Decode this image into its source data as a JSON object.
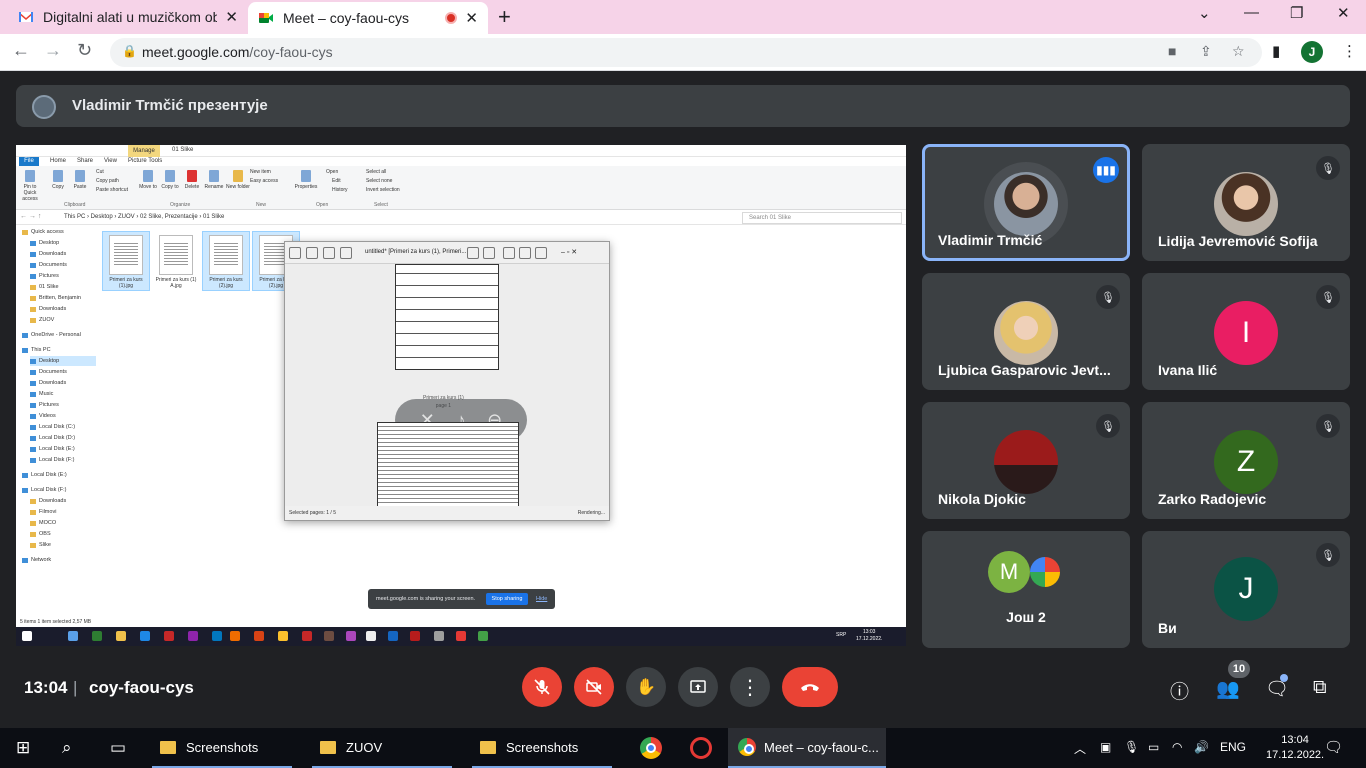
{
  "browser": {
    "tabs": [
      {
        "title": "Digitalni alati u muzičkom obrazovanju",
        "favicon": "gmail-icon"
      },
      {
        "title": "Meet – coy-faou-cys",
        "favicon": "meet-icon",
        "recording": true
      }
    ],
    "url_host": "meet.google.com",
    "url_path": "/coy-faou-cys",
    "profile_initial": "J"
  },
  "presenter_banner": "Vladimir Trmčić презентује",
  "shared_screen": {
    "explorer": {
      "title": "01 Slike",
      "manage_tab": "Manage",
      "ribbon_tabs": [
        "File",
        "Home",
        "Share",
        "View",
        "Picture Tools"
      ],
      "ribbon_buttons": [
        "Pin to Quick access",
        "Copy",
        "Paste",
        "Move to",
        "Copy to",
        "Delete",
        "Rename",
        "New folder",
        "Properties",
        "Open",
        "Select all"
      ],
      "ribbon_small": [
        "Cut",
        "Copy path",
        "Paste shortcut",
        "New item",
        "Easy access",
        "Edit",
        "History",
        "Select none",
        "Invert selection"
      ],
      "ribbon_groups": [
        "Clipboard",
        "Organize",
        "New",
        "Open",
        "Select"
      ],
      "path": "This PC  ›  Desktop  ›  ZUOV  ›  02 Slike, Prezentacije  ›  01 Slike",
      "search_placeholder": "Search 01 Slike",
      "nav": [
        "Quick access",
        "Desktop",
        "Downloads",
        "Documents",
        "Pictures",
        "01 Slike",
        "Britten, Benjamin",
        "Downloads",
        "ZUOV",
        "OneDrive - Personal",
        "This PC",
        "Desktop",
        "Documents",
        "Downloads",
        "Music",
        "Pictures",
        "Videos",
        "Local Disk (C:)",
        "Local Disk (D:)",
        "Local Disk (E:)",
        "Local Disk (F:)",
        "Local Disk (E:)",
        "Local Disk (F:)",
        "Downloads",
        "Filmovi",
        "MOCO",
        "OBS",
        "Slike",
        "Network"
      ],
      "thumbs": [
        "Primeri za kurs (1).jpg",
        "Primeri za kurs (1) A.jpg",
        "Primeri za kurs (2).jpg",
        "Primeri za kurs (2).jpg"
      ],
      "status": "5 items    1 item selected  2,57 MB"
    },
    "viewer": {
      "title": "untitled* [Primeri za kurs (1), Primeri...",
      "page_caption": "Primeri za kurs (1)\npage 1",
      "footer_left": "Selected pages: 1 / 5",
      "footer_right": "Rendering..."
    },
    "share_notice": {
      "text": "meet.google.com is sharing your screen.",
      "stop": "Stop sharing",
      "hide": "Hide"
    },
    "taskbar_clock": [
      "13:03",
      "17.12.2022."
    ],
    "taskbar_lang": "SRP"
  },
  "participants": [
    {
      "name": "Vladimir Trmčić",
      "state": "speaking"
    },
    {
      "name": "Lidija Jevremović Sofija",
      "state": "muted"
    },
    {
      "name": "Ljubica Gasparovic Jevt...",
      "state": "muted"
    },
    {
      "name": "Ivana Ilić",
      "state": "muted",
      "initial": "I",
      "color": "#e91e63"
    },
    {
      "name": "Nikola Djokic",
      "state": "muted"
    },
    {
      "name": "Zarko Radojevic",
      "state": "muted",
      "initial": "Z",
      "color": "#33691e"
    },
    {
      "name": "Још 2",
      "initial": "M"
    },
    {
      "name": "Ви",
      "state": "muted",
      "initial": "J",
      "color": "#0b5345"
    }
  ],
  "controls": {
    "time": "13:04",
    "separator": "|",
    "meeting_code": "coy-faou-cys",
    "people_count": "10"
  },
  "taskbar": {
    "items": [
      "Screenshots",
      "ZUOV",
      "Screenshots",
      "Meet – coy-faou-c..."
    ],
    "lang": "ENG",
    "time": "13:04",
    "date": "17.12.2022."
  },
  "colors": {
    "meet_bg": "#202124",
    "tile_bg": "#3c4043",
    "danger": "#ea4335",
    "accent": "#8ab4f8",
    "tab_strip": "#f6d3e8"
  }
}
